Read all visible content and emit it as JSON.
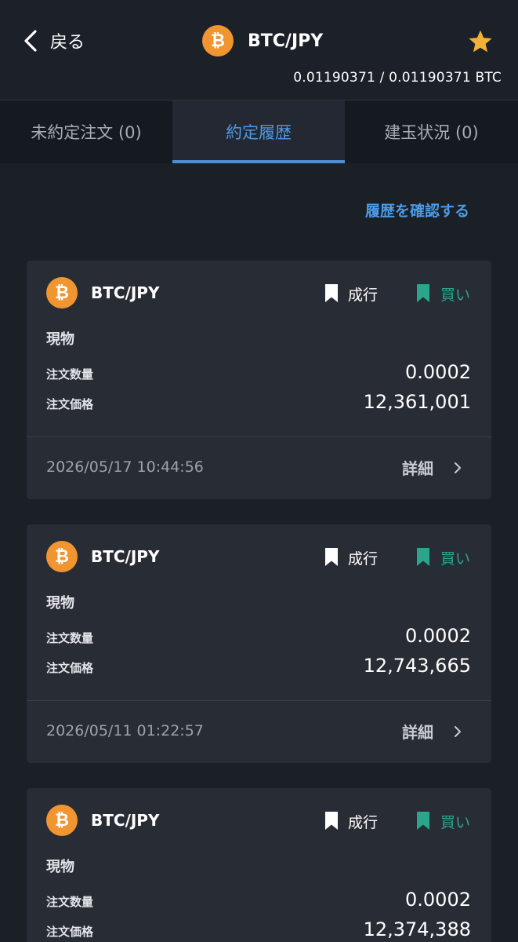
{
  "header": {
    "back_label": "戻る",
    "title": "BTC/JPY",
    "balance": "0.01190371 / 0.01190371  BTC",
    "coin_symbol": "₿"
  },
  "tabs": [
    {
      "label": "未約定注文 (0)",
      "active": false
    },
    {
      "label": "約定履歴",
      "active": true
    },
    {
      "label": "建玉状況 (0)",
      "active": false
    }
  ],
  "history_link": "履歴を確認する",
  "labels": {
    "quantity": "注文数量",
    "price": "注文価格",
    "detail": "詳細"
  },
  "trades": [
    {
      "pair": "BTC/JPY",
      "order_type": "成行",
      "side": "買い",
      "product": "現物",
      "quantity": "0.0002",
      "price": "12,361,001",
      "datetime": "2026/05/17 10:44:56"
    },
    {
      "pair": "BTC/JPY",
      "order_type": "成行",
      "side": "買い",
      "product": "現物",
      "quantity": "0.0002",
      "price": "12,743,665",
      "datetime": "2026/05/11 01:22:57"
    },
    {
      "pair": "BTC/JPY",
      "order_type": "成行",
      "side": "買い",
      "product": "現物",
      "quantity": "0.0002",
      "price": "12,374,388",
      "datetime": ""
    }
  ],
  "colors": {
    "background": "#1b1f26",
    "accent": "#4a9be6",
    "buy": "#2ca58d",
    "btc": "#f0952f",
    "star": "#f2b134"
  },
  "icons": {
    "back": "chevron-left-icon",
    "favorite": "star-icon",
    "coin": "bitcoin-icon",
    "order_type": "bookmark-icon",
    "side": "bookmark-icon",
    "detail": "chevron-right-icon"
  }
}
